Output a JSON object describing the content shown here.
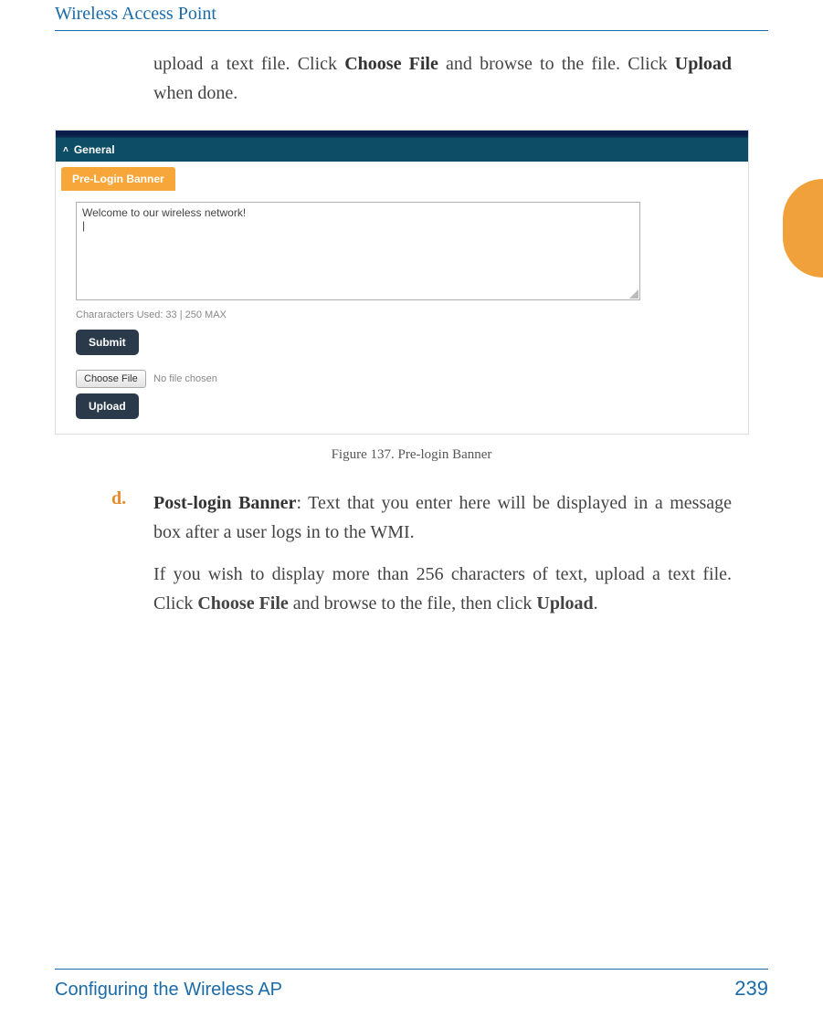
{
  "header": {
    "title": "Wireless Access Point"
  },
  "intro": {
    "before_choose": "upload a text file. Click ",
    "choose_file": "Choose File",
    "between": " and browse to the file. Click ",
    "upload": "Upload",
    "after": " when done."
  },
  "screenshot": {
    "general_label": "General",
    "section_label": "Pre-Login Banner",
    "textarea_value": "Welcome to our wireless network!",
    "charcount_text": "Chararacters Used:  33 | 250 MAX",
    "submit_label": "Submit",
    "choose_file_label": "Choose File",
    "no_file_text": "No file chosen",
    "upload_label": "Upload"
  },
  "figure_caption": "Figure 137. Pre-login Banner",
  "item_d": {
    "marker": "d.",
    "title": "Post-login Banner",
    "after_title": ": Text that you enter here will be displayed in a message box after a user logs in to the WMI.",
    "para2_before": "If you wish to display more than 256 characters of text, upload a text file. Click ",
    "choose_file": "Choose File",
    "para2_mid": " and browse to the file, then click ",
    "upload": "Upload",
    "para2_after": "."
  },
  "footer": {
    "left": "Configuring the Wireless AP",
    "right": "239"
  }
}
